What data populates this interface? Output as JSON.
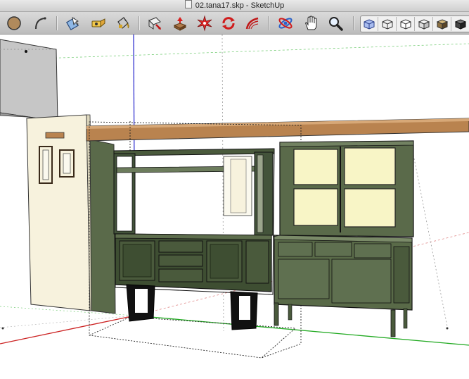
{
  "window": {
    "title": "02.tana17.skp - SketchUp"
  },
  "toolbar": {
    "tools": [
      {
        "name": "circle-tool-icon"
      },
      {
        "name": "arc-tool-icon"
      },
      {
        "name": "select-tool-icon"
      },
      {
        "name": "eraser-tool-icon"
      },
      {
        "name": "paint-bucket-icon"
      },
      {
        "name": "push-pull-icon"
      },
      {
        "name": "move-tool-icon"
      },
      {
        "name": "rotate-tool-icon"
      },
      {
        "name": "follow-me-icon"
      },
      {
        "name": "offset-tool-icon"
      },
      {
        "name": "orbit-tool-icon"
      },
      {
        "name": "pan-tool-icon"
      },
      {
        "name": "zoom-tool-icon"
      }
    ],
    "face_styles": [
      {
        "name": "xray-style-icon"
      },
      {
        "name": "wireframe-style-icon"
      },
      {
        "name": "hidden-line-style-icon"
      },
      {
        "name": "shaded-style-icon"
      },
      {
        "name": "shaded-textures-style-icon"
      },
      {
        "name": "monochrome-style-icon"
      }
    ]
  },
  "colors": {
    "axis_red": "#cc2222",
    "axis_green": "#22aa22",
    "axis_blue": "#2222cc",
    "cabinet_green": "#4a5a3c",
    "glass_yellow": "#f8f5c6",
    "wall_cream": "#f7f2dd",
    "countertop": "#b9834f"
  }
}
